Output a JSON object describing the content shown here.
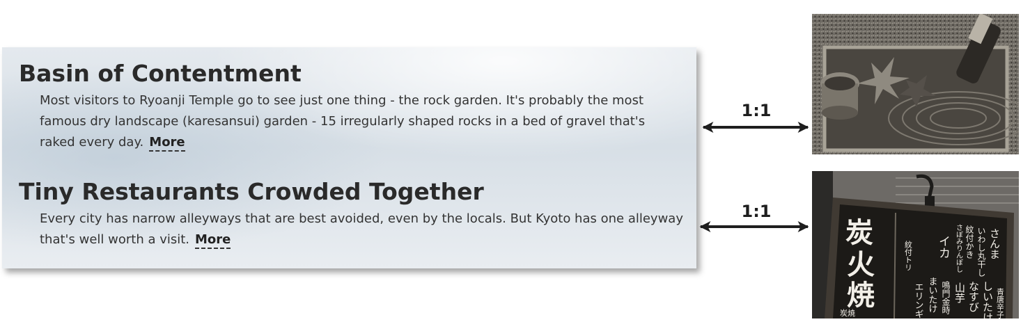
{
  "articles": [
    {
      "title": "Basin of Contentment",
      "body": "Most visitors to Ryoanji Temple go to see just one thing - the rock garden. It's probably the most famous dry landscape (karesansui) garden - 15 irregularly shaped rocks in a bed of gravel that's raked every day.",
      "more_label": "More"
    },
    {
      "title": "Tiny Restaurants Crowded Together",
      "body": "Every city has narrow alleyways that are best avoided, even by the locals. But Kyoto has one alleyway that's well worth a visit.",
      "more_label": "More"
    }
  ],
  "ratios": [
    "1:1",
    "1:1"
  ],
  "sign": {
    "big_text": [
      "炭",
      "火",
      "焼"
    ],
    "col_1": "さんま",
    "col_2": "いわし丸干し",
    "col_3": "紋付かき",
    "col_4": "さぼみりんぼし",
    "col_5": "イカ",
    "col_6": "紋付トリ",
    "col_7": "青唐辛子",
    "col_8": "しいたけ",
    "col_9": "なすび",
    "col_10": "山芋",
    "col_11": "鳴門金時",
    "col_12": "まいたけ",
    "col_13": "エリンギ",
    "bottom": "炭焼"
  },
  "colors": {
    "text": "#333333",
    "heading": "#2a2a2a",
    "arrow": "#1e1e1e"
  }
}
